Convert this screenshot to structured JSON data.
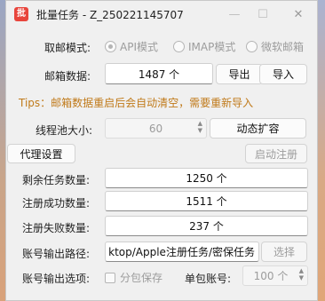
{
  "window": {
    "title": "批量任务 - Z_250221145707",
    "app_icon_glyph": "批",
    "controls": {
      "minimize": "—",
      "maximize": "☐",
      "close": "✕"
    }
  },
  "mailbox_mode": {
    "label": "取邮模式:",
    "options": [
      {
        "label": "API模式",
        "selected": true
      },
      {
        "label": "IMAP模式",
        "selected": false
      },
      {
        "label": "微软邮箱",
        "selected": false
      }
    ]
  },
  "mailbox_data": {
    "label": "邮箱数据:",
    "value": "1487 个",
    "export_button": "导出",
    "import_button": "导入"
  },
  "tips": "Tips：邮箱数据重启后会自动清空，需要重新导入",
  "thread_pool": {
    "label": "线程池大小:",
    "value": "60",
    "expand_button": "动态扩容"
  },
  "proxy_button": "代理设置",
  "start_button": "启动注册",
  "stats": {
    "remaining": {
      "label": "剩余任务数量:",
      "value": "1250 个"
    },
    "success": {
      "label": "注册成功数量:",
      "value": "1511 个"
    },
    "failed": {
      "label": "注册失败数量:",
      "value": "237 个"
    }
  },
  "output_path": {
    "label": "账号输出路径:",
    "value": "ktop/Apple注册任务/密保任务",
    "select_button": "选择"
  },
  "output_options": {
    "label": "账号输出选项:",
    "split_checkbox": "分包保存",
    "per_pack_label": "单包账号:",
    "per_pack_value": "100 个"
  },
  "colors": {
    "tips": "#c07a1a",
    "app_icon": "#e8453c",
    "disabled_text": "#9c9c9c"
  }
}
